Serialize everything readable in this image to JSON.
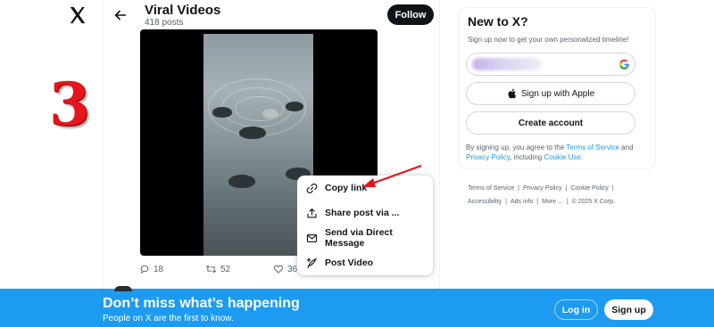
{
  "annotation": {
    "step_number": "3"
  },
  "header": {
    "title": "Viral Videos",
    "post_count": "418 posts",
    "follow_label": "Follow"
  },
  "post": {
    "replies": "18",
    "reposts": "52",
    "likes": "368"
  },
  "share_menu": {
    "items": [
      {
        "label": "Copy link",
        "icon": "link-icon"
      },
      {
        "label": "Share post via ...",
        "icon": "share-icon"
      },
      {
        "label": "Send via Direct Message",
        "icon": "envelope-icon"
      },
      {
        "label": "Post Video",
        "icon": "compose-icon"
      }
    ]
  },
  "signup_card": {
    "title": "New to X?",
    "subtitle": "Sign up now to get your own personalized timeline!",
    "apple_label": "Sign up with Apple",
    "create_label": "Create account",
    "terms_prefix": "By signing up, you agree to the ",
    "terms_link": "Terms of Service",
    "terms_and": " and ",
    "privacy_link": "Privacy Policy",
    "terms_including": ", including ",
    "cookie_link": "Cookie Use",
    "terms_end": "."
  },
  "footer": {
    "links": [
      "Terms of Service",
      "Privacy Policy",
      "Cookie Policy",
      "Accessibility",
      "Ads info",
      "More ..."
    ],
    "copyright": "© 2025 X Corp."
  },
  "banner": {
    "title": "Don’t miss what’s happening",
    "subtitle": "People on X are the first to know.",
    "login_label": "Log in",
    "signup_label": "Sign up"
  },
  "colors": {
    "accent": "#1d9bf0",
    "annotation_red": "#e8141c",
    "text": "#0f1419",
    "muted": "#536471"
  }
}
